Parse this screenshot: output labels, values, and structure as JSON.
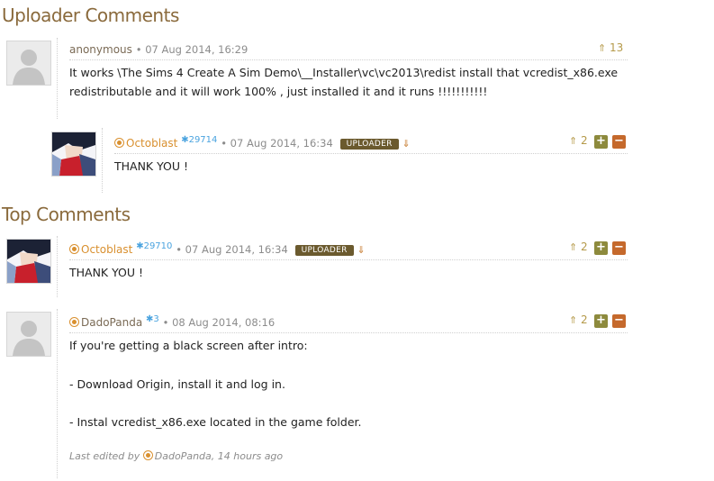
{
  "uploader_section": {
    "title": "Uploader Comments",
    "comment1": {
      "username": "anonymous",
      "date": "07 Aug 2014, 16:29",
      "votes": "13",
      "line1": "It works \\The Sims 4 Create A Sim Demo\\__Installer\\vc\\vc2013\\redist install that vcredist_x86.exe",
      "line2": "redistributable and it will work 100% , just installed it and it runs !!!!!!!!!!!"
    },
    "reply1": {
      "username": "Octoblast",
      "rep": "29714",
      "date": "07 Aug 2014, 16:34",
      "badge": "UPLOADER",
      "votes": "2",
      "text": "THANK YOU !"
    }
  },
  "top_section": {
    "title": "Top Comments",
    "comment1": {
      "username": "Octoblast",
      "rep": "29710",
      "date": "07 Aug 2014, 16:34",
      "badge": "UPLOADER",
      "votes": "2",
      "text": "THANK YOU !"
    },
    "comment2": {
      "username": "DadoPanda",
      "rep": "3",
      "date": "08 Aug 2014, 08:16",
      "votes": "2",
      "line1": "If you're getting a black screen after intro:",
      "line2": "- Download Origin, install it and log in.",
      "line3": "- Instal vcredist_x86.exe located in the game folder.",
      "edited_prefix": "Last edited by",
      "edited_user": "DadoPanda",
      "edited_time": ", 14 hours ago"
    }
  },
  "icons": {
    "plus": "+",
    "minus": "−",
    "up_arrow": "⇑",
    "down_arrow": "⇓",
    "rep_star": "✱"
  },
  "colors": {
    "section_title": "#8a6a3c",
    "username_orange": "#d9902f",
    "reputation_blue": "#4aa3df",
    "uploader_badge": "#6b5a2e",
    "vote_plus": "#8d8a3d",
    "vote_minus": "#c5692c"
  }
}
